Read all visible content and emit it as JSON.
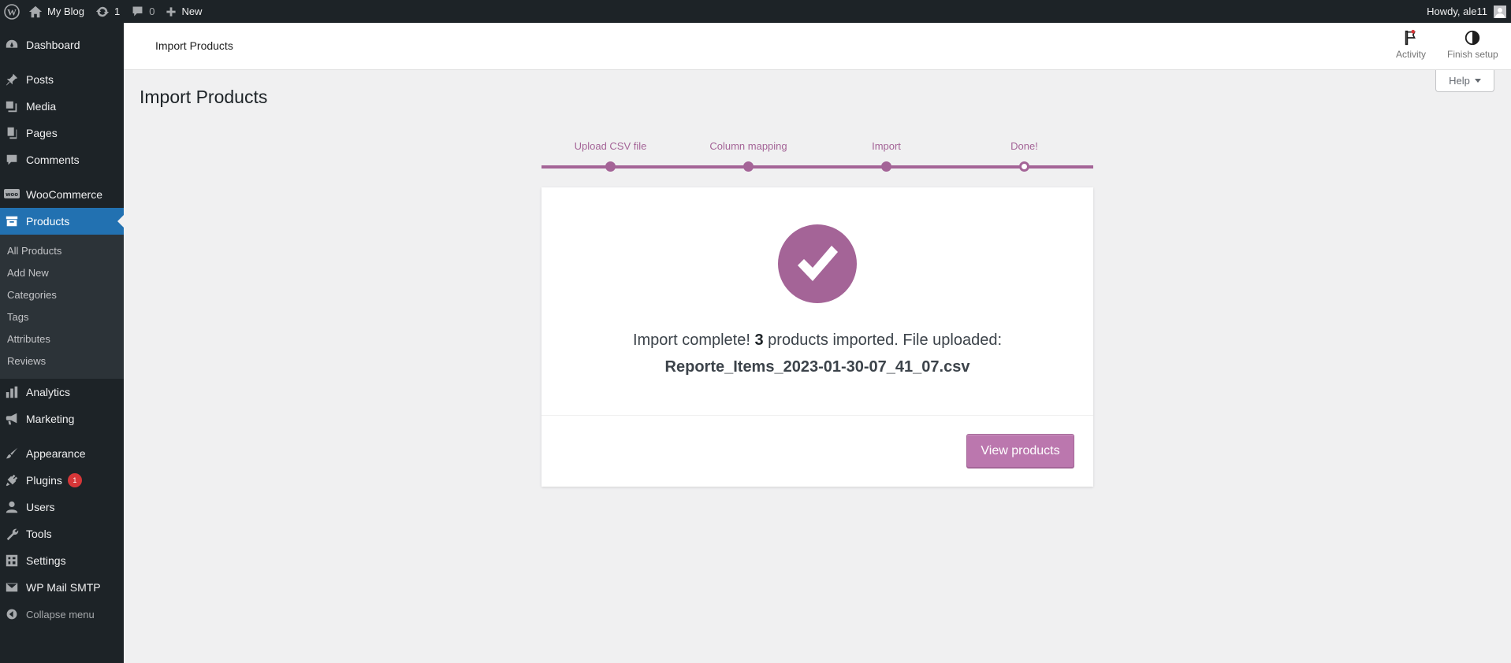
{
  "adminbar": {
    "site_name": "My Blog",
    "updates_count": "1",
    "comments_count": "0",
    "new_label": "New",
    "howdy": "Howdy, ale11"
  },
  "sidebar": {
    "items": [
      {
        "label": "Dashboard",
        "icon": "dashboard-icon"
      },
      {
        "label": "Posts",
        "icon": "pin-icon"
      },
      {
        "label": "Media",
        "icon": "media-icon"
      },
      {
        "label": "Pages",
        "icon": "pages-icon"
      },
      {
        "label": "Comments",
        "icon": "comment-icon"
      },
      {
        "label": "WooCommerce",
        "icon": "woo-icon"
      },
      {
        "label": "Products",
        "icon": "archive-icon"
      },
      {
        "label": "Analytics",
        "icon": "chart-icon"
      },
      {
        "label": "Marketing",
        "icon": "megaphone-icon"
      },
      {
        "label": "Appearance",
        "icon": "brush-icon"
      },
      {
        "label": "Plugins",
        "icon": "plug-icon",
        "badge": "1"
      },
      {
        "label": "Users",
        "icon": "user-icon"
      },
      {
        "label": "Tools",
        "icon": "wrench-icon"
      },
      {
        "label": "Settings",
        "icon": "settings-icon"
      },
      {
        "label": "WP Mail SMTP",
        "icon": "mail-icon"
      }
    ],
    "products_submenu": [
      "All Products",
      "Add New",
      "Categories",
      "Tags",
      "Attributes",
      "Reviews"
    ],
    "collapse_label": "Collapse menu"
  },
  "header": {
    "title": "Import Products",
    "activity_label": "Activity",
    "finish_setup_label": "Finish setup"
  },
  "help_label": "Help",
  "page_title": "Import Products",
  "steps": [
    "Upload CSV file",
    "Column mapping",
    "Import",
    "Done!"
  ],
  "result": {
    "prefix": "Import complete!",
    "count": "3",
    "suffix": "products imported. File uploaded:",
    "filename": "Reporte_Items_2023-01-30-07_41_07.csv"
  },
  "view_products_label": "View products",
  "colors": {
    "accent": "#a46497",
    "button": "#bb77ae",
    "sidebar_bg": "#1d2327",
    "current_menu": "#2271b1"
  }
}
